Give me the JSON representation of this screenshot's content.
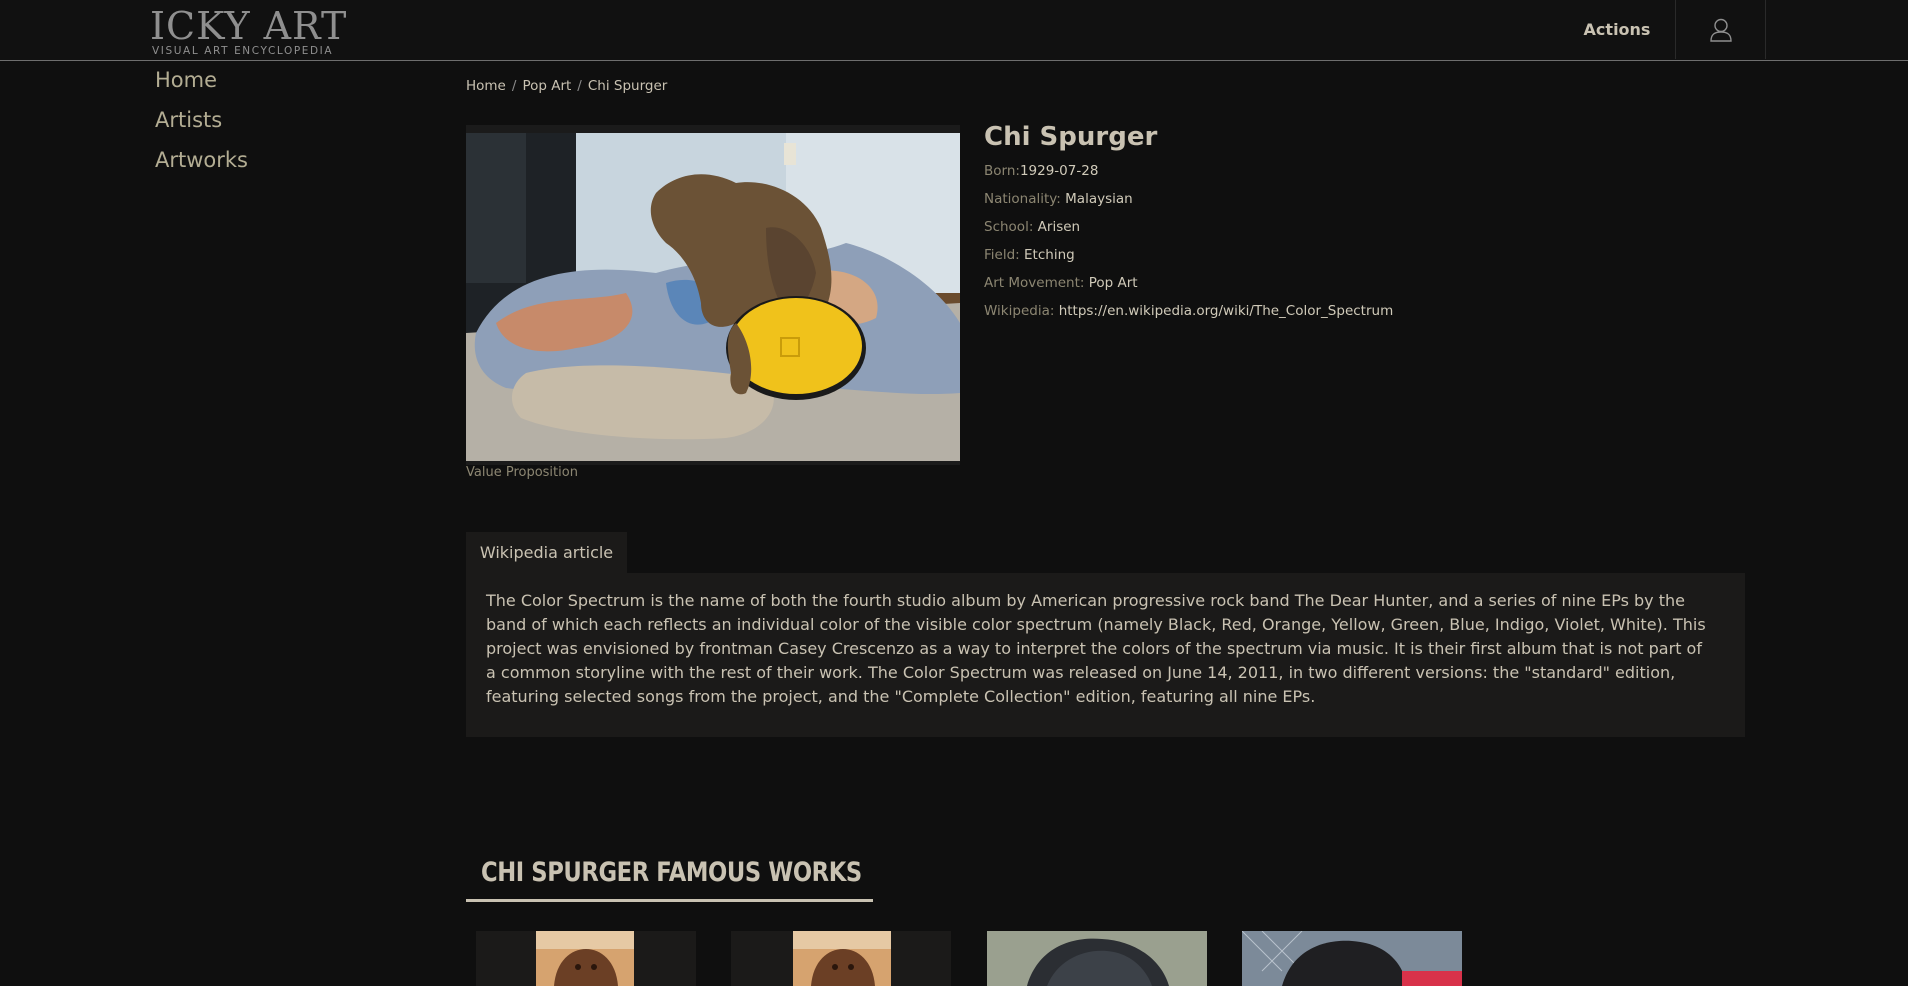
{
  "header": {
    "logo_main": "ICKY ART",
    "logo_sub": "VISUAL ART ENCYCLOPEDIA",
    "actions_label": "Actions",
    "user_icon": "user-icon"
  },
  "sidebar": {
    "items": [
      {
        "label": "Home"
      },
      {
        "label": "Artists"
      },
      {
        "label": "Artworks"
      }
    ]
  },
  "breadcrumb": {
    "items": [
      "Home",
      "Pop Art",
      "Chi Spurger"
    ],
    "separator": "/"
  },
  "artist": {
    "name": "Chi Spurger",
    "photo_caption": "Value Proposition",
    "fields": [
      {
        "label": "Born:",
        "value": "1929-07-28"
      },
      {
        "label": "Nationality:",
        "value": "Malaysian"
      },
      {
        "label": "School:",
        "value": "Arisen"
      },
      {
        "label": "Field:",
        "value": "Etching"
      },
      {
        "label": "Art Movement:",
        "value": "Pop Art"
      },
      {
        "label": "Wikipedia:",
        "value": "https://en.wikipedia.org/wiki/The_Color_Spectrum"
      }
    ]
  },
  "article": {
    "tab_label": "Wikipedia article",
    "text": "The Color Spectrum is the name of both the fourth studio album by American progressive rock band The Dear Hunter, and a series of nine EPs by the band of which each reflects an individual color of the visible color spectrum (namely Black, Red, Orange, Yellow, Green, Blue, Indigo, Violet, White). This project was envisioned by frontman Casey Crescenzo as a way to interpret the colors of the spectrum via music. It is their first album that is not part of a common storyline with the rest of their work. The Color Spectrum was released on June 14, 2011, in two different versions: the \"standard\" edition, featuring selected songs from the project, and the \"Complete Collection\" edition, featuring all nine EPs."
  },
  "famous_works": {
    "title": "CHI SPURGER  FAMOUS WORKS"
  },
  "colors": {
    "background": "#0f0f0f",
    "panel": "#1b1a19",
    "text": "#c9c2b2",
    "muted": "#8c8672"
  }
}
